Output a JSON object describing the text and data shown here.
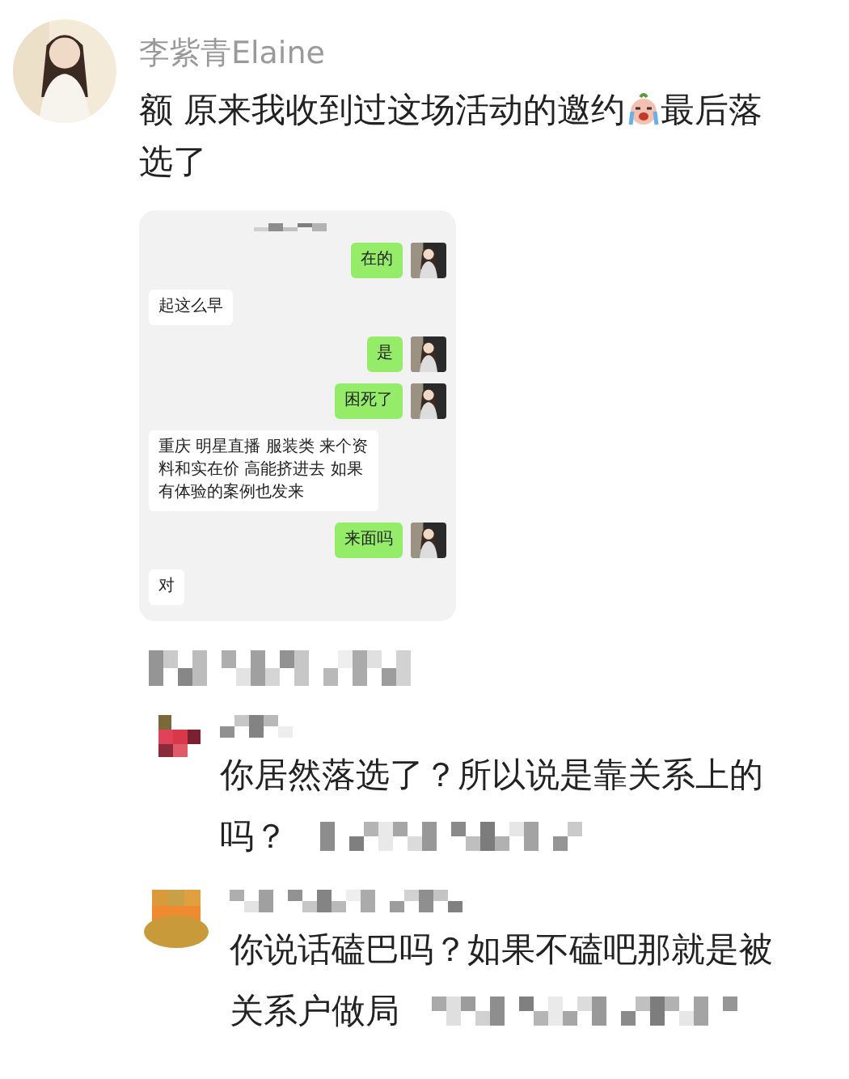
{
  "post": {
    "author": "李紫青Elaine",
    "text_before": "额 原来我收到过这场活动的邀约",
    "text_after_lines": [
      "最后落",
      "选了"
    ],
    "attachment": {
      "kind": "chat_screenshot",
      "messages": [
        {
          "kind": "sent",
          "text": "在的"
        },
        {
          "kind": "received",
          "text": "起这么早"
        },
        {
          "kind": "sent",
          "text": "是"
        },
        {
          "kind": "sent",
          "text": "困死了"
        },
        {
          "kind": "received",
          "text": "重庆 明星直播 服装类 来个资料和实在价 高能挤进去 如果有体验的案例也发来"
        },
        {
          "kind": "sent",
          "text": "来面吗"
        },
        {
          "kind": "received",
          "text": "对"
        }
      ]
    }
  },
  "replies": [
    {
      "lines": [
        "你居然落选了？所以说是靠关系上的",
        "吗？"
      ]
    },
    {
      "lines": [
        "你说话磕巴吗？如果不磕吧那就是被",
        "关系户做局"
      ]
    }
  ]
}
